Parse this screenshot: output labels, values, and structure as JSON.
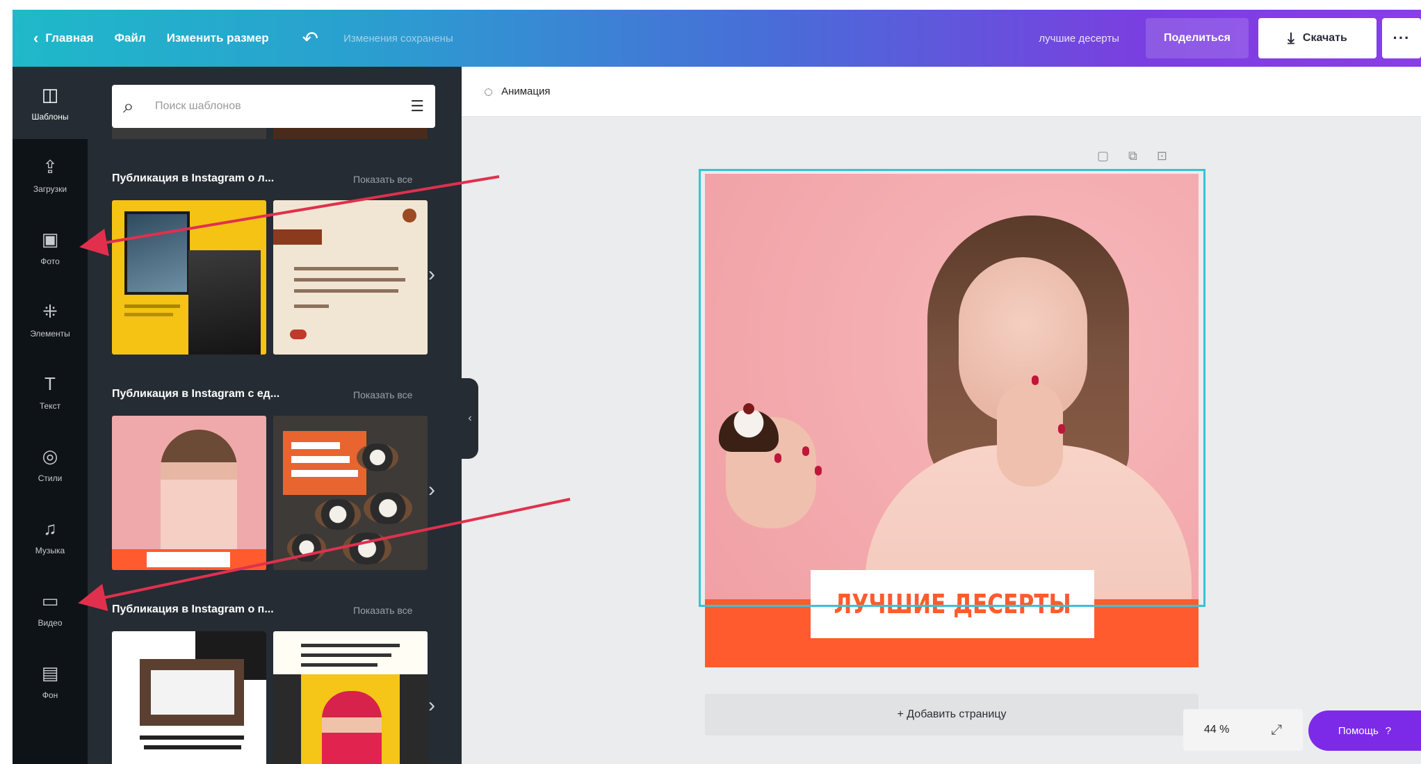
{
  "colors": {
    "brand_gradient_start": "#1fb9c9",
    "brand_gradient_end": "#8a3ee6",
    "sidebar_dark": "#0e1318",
    "panel_dark": "#252c33",
    "accent_orange": "#ff5b2e",
    "selection_cyan": "#38c2d6",
    "help_purple": "#7d2ae8",
    "annotation_arrow": "#e0304e"
  },
  "topbar": {
    "home_label": "Главная",
    "file_label": "Файл",
    "resize_label": "Изменить размер",
    "undo_icon": "undo-icon",
    "saved_status": "Изменения сохранены",
    "design_name": "лучшие десерты",
    "share_label": "Поделиться",
    "download_label": "Скачать",
    "more_label": "···"
  },
  "sidebar": {
    "items": [
      {
        "icon": "templates-icon",
        "label": "Шаблоны"
      },
      {
        "icon": "upload-icon",
        "label": "Загрузки"
      },
      {
        "icon": "photo-icon",
        "label": "Фото"
      },
      {
        "icon": "elements-icon",
        "label": "Элементы"
      },
      {
        "icon": "text-icon",
        "label": "Текст"
      },
      {
        "icon": "styles-icon",
        "label": "Стили"
      },
      {
        "icon": "music-icon",
        "label": "Музыка"
      },
      {
        "icon": "video-icon",
        "label": "Видео"
      },
      {
        "icon": "background-icon",
        "label": "Фон"
      }
    ]
  },
  "templates_panel": {
    "search_placeholder": "Поиск шаблонов",
    "sections": [
      {
        "title": "Публикация в Instagram о л...",
        "see_all": "Показать все"
      },
      {
        "title": "Публикация в Instagram с ед...",
        "see_all": "Показать все"
      },
      {
        "title": "Публикация в Instagram о п...",
        "see_all": "Показать все"
      }
    ]
  },
  "canvas": {
    "animation_label": "Анимация",
    "design_title": "ЛУЧШИЕ ДЕСЕРТЫ",
    "add_page_label": "+ Добавить страницу"
  },
  "footer": {
    "zoom": "44 %",
    "help_label": "Помощь",
    "help_icon": "?"
  }
}
